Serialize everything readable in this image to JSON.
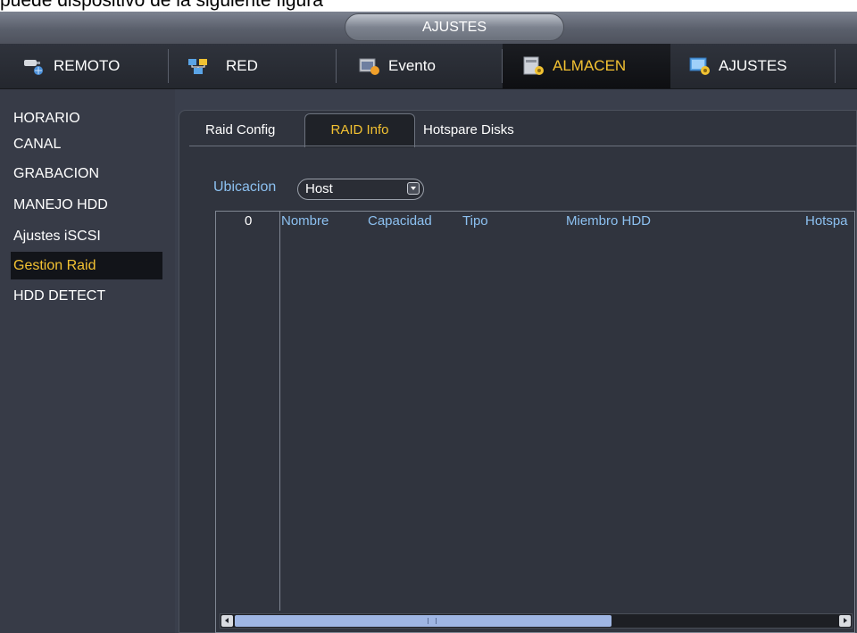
{
  "page_caption": "puede dispositivo de la siguiente figura",
  "window": {
    "title": "AJUSTES"
  },
  "main_tabs": [
    {
      "label": "REMOTO",
      "icon": "camera-network-icon"
    },
    {
      "label": "RED",
      "icon": "network-icon"
    },
    {
      "label": "Evento",
      "icon": "event-icon"
    },
    {
      "label": "ALMACEN",
      "icon": "storage-settings-icon",
      "active": true
    },
    {
      "label": "AJUSTES",
      "icon": "system-settings-icon"
    }
  ],
  "sidebar": {
    "items": [
      {
        "label": "HORARIO"
      },
      {
        "label": "CANAL"
      },
      {
        "label": "GRABACION"
      },
      {
        "label": "MANEJO HDD"
      },
      {
        "label": "Ajustes iSCSI"
      },
      {
        "label": "Gestion Raid",
        "active": true
      },
      {
        "label": "HDD DETECT"
      }
    ]
  },
  "sub_tabs": [
    {
      "label": "Raid Config"
    },
    {
      "label": "RAID Info",
      "active": true
    },
    {
      "label": "Hotspare Disks"
    }
  ],
  "location": {
    "label": "Ubicacion",
    "value": "Host"
  },
  "table": {
    "columns": [
      "0",
      "Nombre",
      "Capacidad",
      "Tipo",
      "Miembro HDD",
      "Hotspa"
    ],
    "rows": []
  },
  "colors": {
    "accent": "#f3c232",
    "label_blue": "#8cc0f0",
    "panel": "#30343e"
  }
}
